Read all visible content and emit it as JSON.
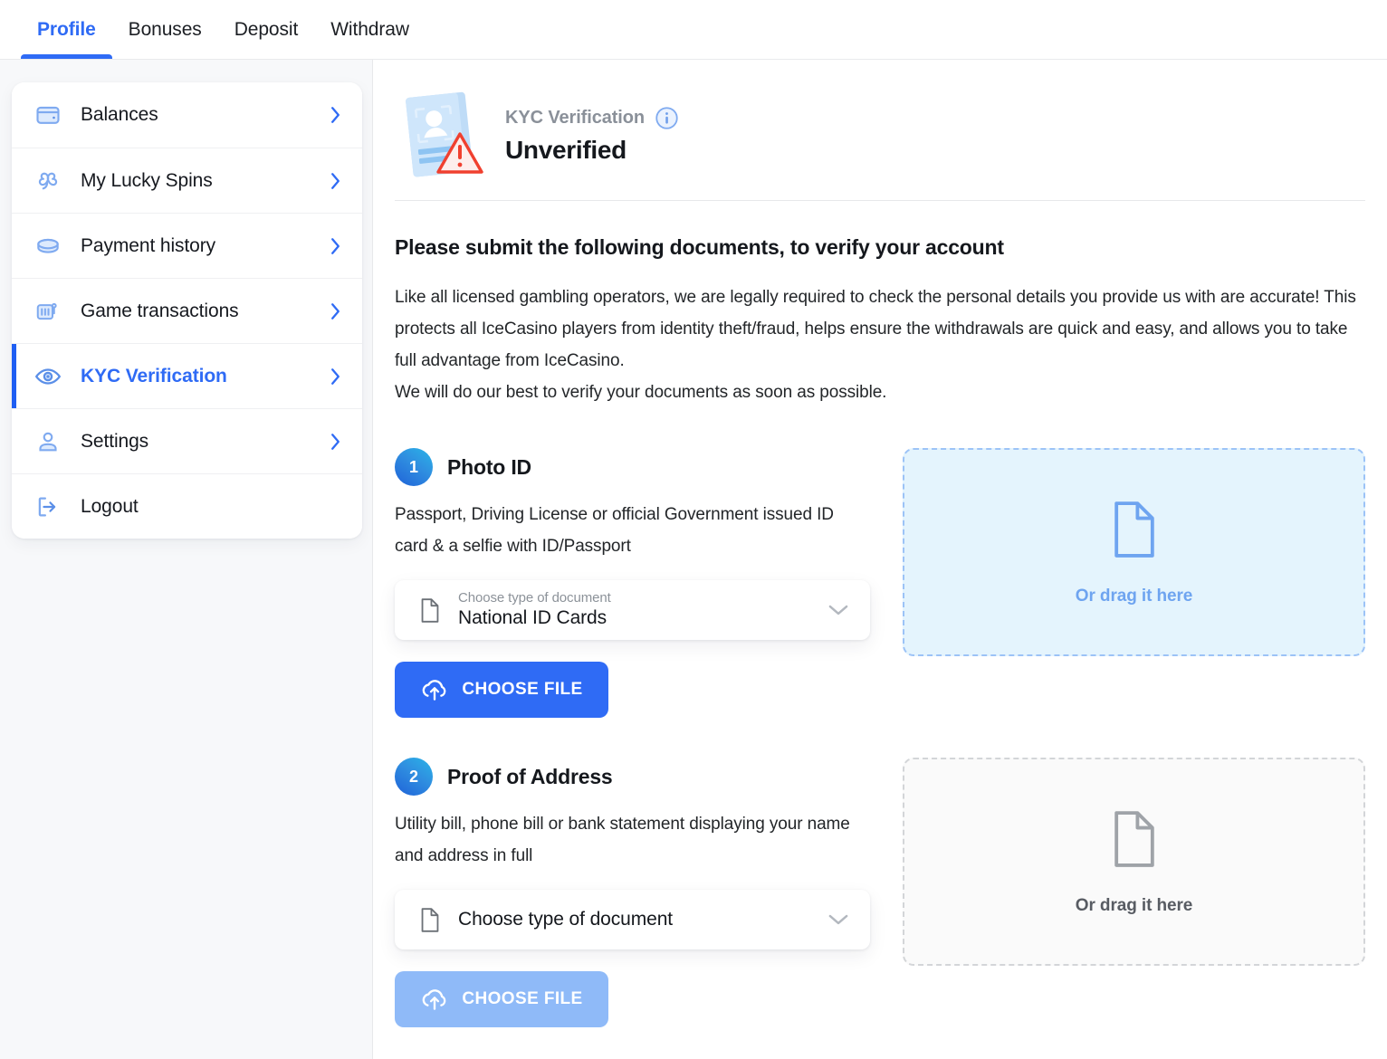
{
  "tabs": [
    {
      "label": "Profile",
      "active": true
    },
    {
      "label": "Bonuses",
      "active": false
    },
    {
      "label": "Deposit",
      "active": false
    },
    {
      "label": "Withdraw",
      "active": false
    }
  ],
  "sidebar": {
    "items": [
      {
        "label": "Balances",
        "icon": "wallet-icon",
        "active": false,
        "chevron": true
      },
      {
        "label": "My Lucky Spins",
        "icon": "clover-icon",
        "active": false,
        "chevron": true
      },
      {
        "label": "Payment history",
        "icon": "coin-icon",
        "active": false,
        "chevron": true
      },
      {
        "label": "Game transactions",
        "icon": "slot-machine-icon",
        "active": false,
        "chevron": true
      },
      {
        "label": "KYC Verification",
        "icon": "eye-icon",
        "active": true,
        "chevron": true
      },
      {
        "label": "Settings",
        "icon": "user-icon",
        "active": false,
        "chevron": true
      },
      {
        "label": "Logout",
        "icon": "logout-icon",
        "active": false,
        "chevron": false
      }
    ]
  },
  "header": {
    "kyc_label": "KYC Verification",
    "status": "Unverified",
    "info_icon": "info-circle-icon",
    "illustration": "id-card-warning-illustration"
  },
  "intro": {
    "heading": "Please submit the following documents, to verify your account",
    "paragraph_1": "Like all licensed gambling operators, we are legally required to check the personal details you provide us with are accurate! This protects all IceCasino players from identity theft/fraud, helps ensure the withdrawals are quick and easy, and allows you to take full advantage from IceCasino.",
    "paragraph_2": "We will do our best to verify your documents as soon as possible."
  },
  "steps": [
    {
      "number": "1",
      "title": "Photo ID",
      "description": "Passport, Driving License or official Government issued ID card & a selfie with ID/Passport",
      "select": {
        "sublabel": "Choose type of document",
        "value": "National ID Cards",
        "has_sublabel": true
      },
      "button_label": "CHOOSE FILE",
      "button_disabled": false,
      "dropzone": {
        "label": "Or drag it here",
        "highlighted": true
      }
    },
    {
      "number": "2",
      "title": "Proof of Address",
      "description": "Utility bill, phone bill or bank statement displaying your name and address in full",
      "select": {
        "sublabel": "",
        "value": "Choose type of document",
        "has_sublabel": false
      },
      "button_label": "CHOOSE FILE",
      "button_disabled": true,
      "dropzone": {
        "label": "Or drag it here",
        "highlighted": false
      }
    }
  ],
  "colors": {
    "accent_blue": "#2f6bf5",
    "accent_blue_disabled": "#8fbaf8",
    "dropzone_blue_bg": "#e4f4fd",
    "icon_blue": "#7faaf0",
    "warning_red": "#f0402f",
    "page_bg": "#f7f8fa"
  }
}
